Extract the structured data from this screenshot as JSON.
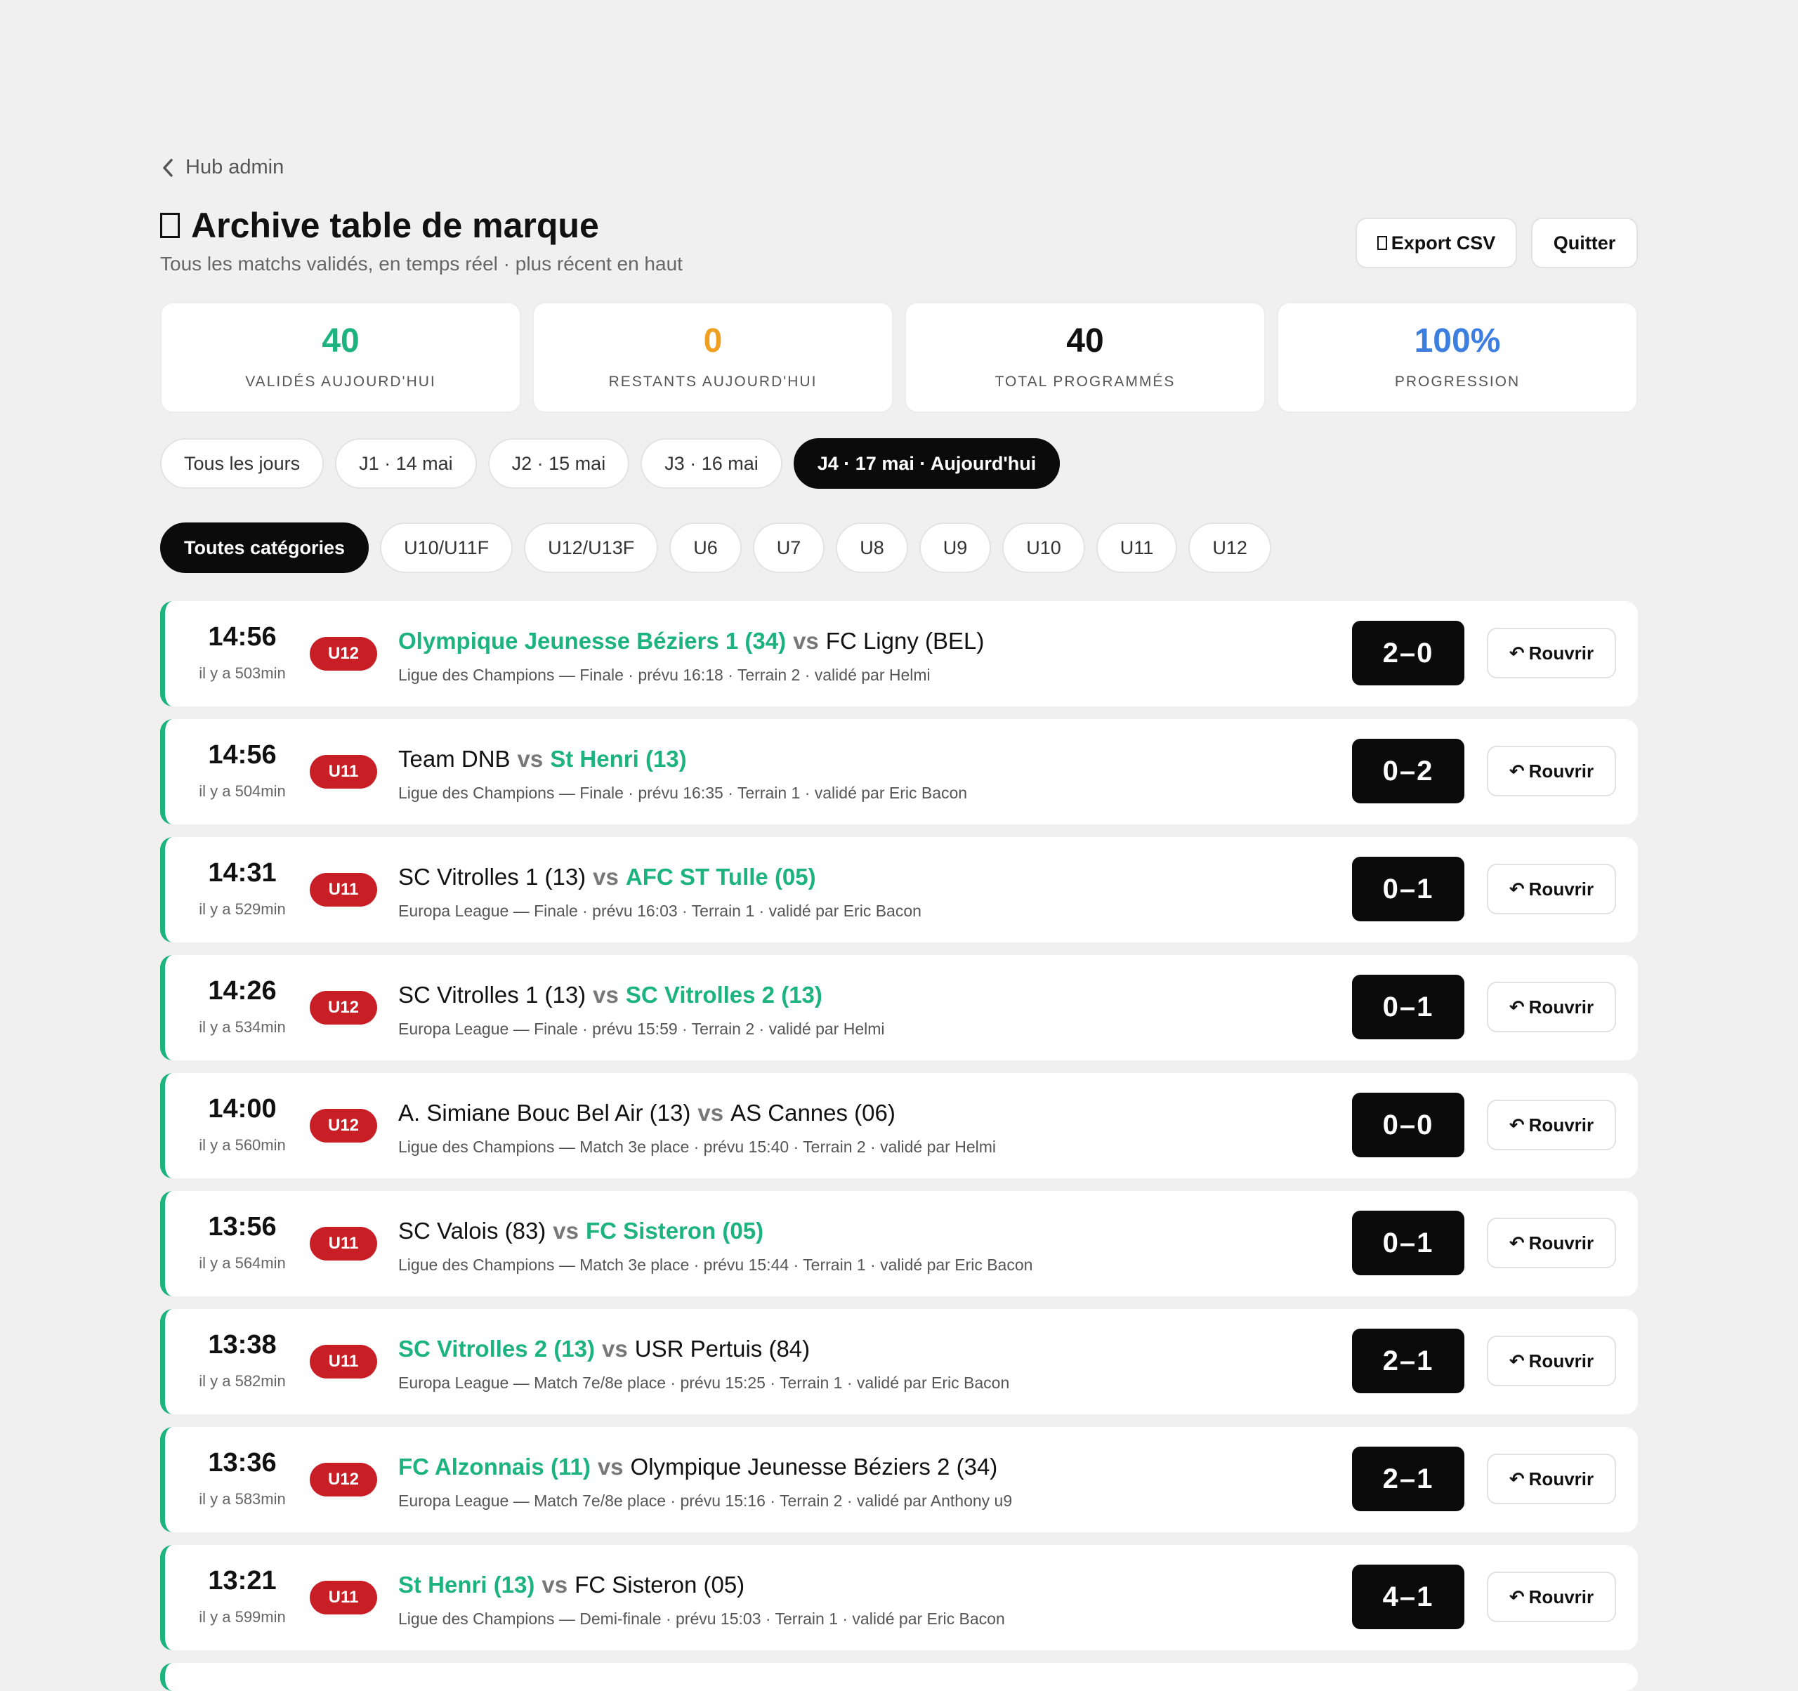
{
  "nav": {
    "back_label": "Hub admin"
  },
  "header": {
    "title": "Archive table de marque",
    "subtitle": "Tous les matchs validés, en temps réel · plus récent en haut",
    "export_label": "Export CSV",
    "quit_label": "Quitter"
  },
  "stats": [
    {
      "value": "40",
      "label": "VALIDÉS AUJOURD'HUI",
      "color": "#1db37f"
    },
    {
      "value": "0",
      "label": "RESTANTS AUJOURD'HUI",
      "color": "#f0a020"
    },
    {
      "value": "40",
      "label": "TOTAL PROGRAMMÉS",
      "color": "#111111"
    },
    {
      "value": "100%",
      "label": "PROGRESSION",
      "color": "#3d7fe0"
    }
  ],
  "days": [
    {
      "label": "Tous les jours",
      "active": false
    },
    {
      "label": "J1 · 14 mai",
      "active": false
    },
    {
      "label": "J2 · 15 mai",
      "active": false
    },
    {
      "label": "J3 · 16 mai",
      "active": false
    },
    {
      "label": "J4 · 17 mai · Aujourd'hui",
      "active": true
    }
  ],
  "categories": [
    {
      "label": "Toutes catégories",
      "active": true
    },
    {
      "label": "U10/U11F",
      "active": false
    },
    {
      "label": "U12/U13F",
      "active": false
    },
    {
      "label": "U6",
      "active": false
    },
    {
      "label": "U7",
      "active": false
    },
    {
      "label": "U8",
      "active": false
    },
    {
      "label": "U9",
      "active": false
    },
    {
      "label": "U10",
      "active": false
    },
    {
      "label": "U11",
      "active": false
    },
    {
      "label": "U12",
      "active": false
    }
  ],
  "reopen_label": "Rouvrir",
  "matches": [
    {
      "time": "14:56",
      "ago": "il y a 503min",
      "category": "U12",
      "home": "Olympique Jeunesse Béziers 1 (34)",
      "away": "FC Ligny (BEL)",
      "winner": "home",
      "meta": "Ligue des Champions — Finale · prévu 16:18 · Terrain 2 · validé par Helmi",
      "score": "2–0"
    },
    {
      "time": "14:56",
      "ago": "il y a 504min",
      "category": "U11",
      "home": "Team DNB",
      "away": "St Henri (13)",
      "winner": "away",
      "meta": "Ligue des Champions — Finale · prévu 16:35 · Terrain 1 · validé par Eric Bacon",
      "score": "0–2"
    },
    {
      "time": "14:31",
      "ago": "il y a 529min",
      "category": "U11",
      "home": "SC Vitrolles 1 (13)",
      "away": "AFC ST Tulle (05)",
      "winner": "away",
      "meta": "Europa League — Finale · prévu 16:03 · Terrain 1 · validé par Eric Bacon",
      "score": "0–1"
    },
    {
      "time": "14:26",
      "ago": "il y a 534min",
      "category": "U12",
      "home": "SC Vitrolles 1 (13)",
      "away": "SC Vitrolles 2 (13)",
      "winner": "away",
      "meta": "Europa League — Finale · prévu 15:59 · Terrain 2 · validé par Helmi",
      "score": "0–1"
    },
    {
      "time": "14:00",
      "ago": "il y a 560min",
      "category": "U12",
      "home": "A. Simiane Bouc Bel Air (13)",
      "away": "AS Cannes (06)",
      "winner": "none",
      "meta": "Ligue des Champions — Match 3e place · prévu 15:40 · Terrain 2 · validé par Helmi",
      "score": "0–0"
    },
    {
      "time": "13:56",
      "ago": "il y a 564min",
      "category": "U11",
      "home": "SC Valois (83)",
      "away": "FC Sisteron (05)",
      "winner": "away",
      "meta": "Ligue des Champions — Match 3e place · prévu 15:44 · Terrain 1 · validé par Eric Bacon",
      "score": "0–1"
    },
    {
      "time": "13:38",
      "ago": "il y a 582min",
      "category": "U11",
      "home": "SC Vitrolles 2 (13)",
      "away": "USR Pertuis (84)",
      "winner": "home",
      "meta": "Europa League — Match 7e/8e place · prévu 15:25 · Terrain 1 · validé par Eric Bacon",
      "score": "2–1"
    },
    {
      "time": "13:36",
      "ago": "il y a 583min",
      "category": "U12",
      "home": "FC Alzonnais (11)",
      "away": "Olympique Jeunesse Béziers 2 (34)",
      "winner": "home",
      "meta": "Europa League — Match 7e/8e place · prévu 15:16 · Terrain 2 · validé par Anthony u9",
      "score": "2–1"
    },
    {
      "time": "13:21",
      "ago": "il y a 599min",
      "category": "U11",
      "home": "St Henri (13)",
      "away": "FC Sisteron (05)",
      "winner": "home",
      "meta": "Ligue des Champions — Demi-finale · prévu 15:03 · Terrain 1 · validé par Eric Bacon",
      "score": "4–1"
    }
  ],
  "vs_label": "vs"
}
